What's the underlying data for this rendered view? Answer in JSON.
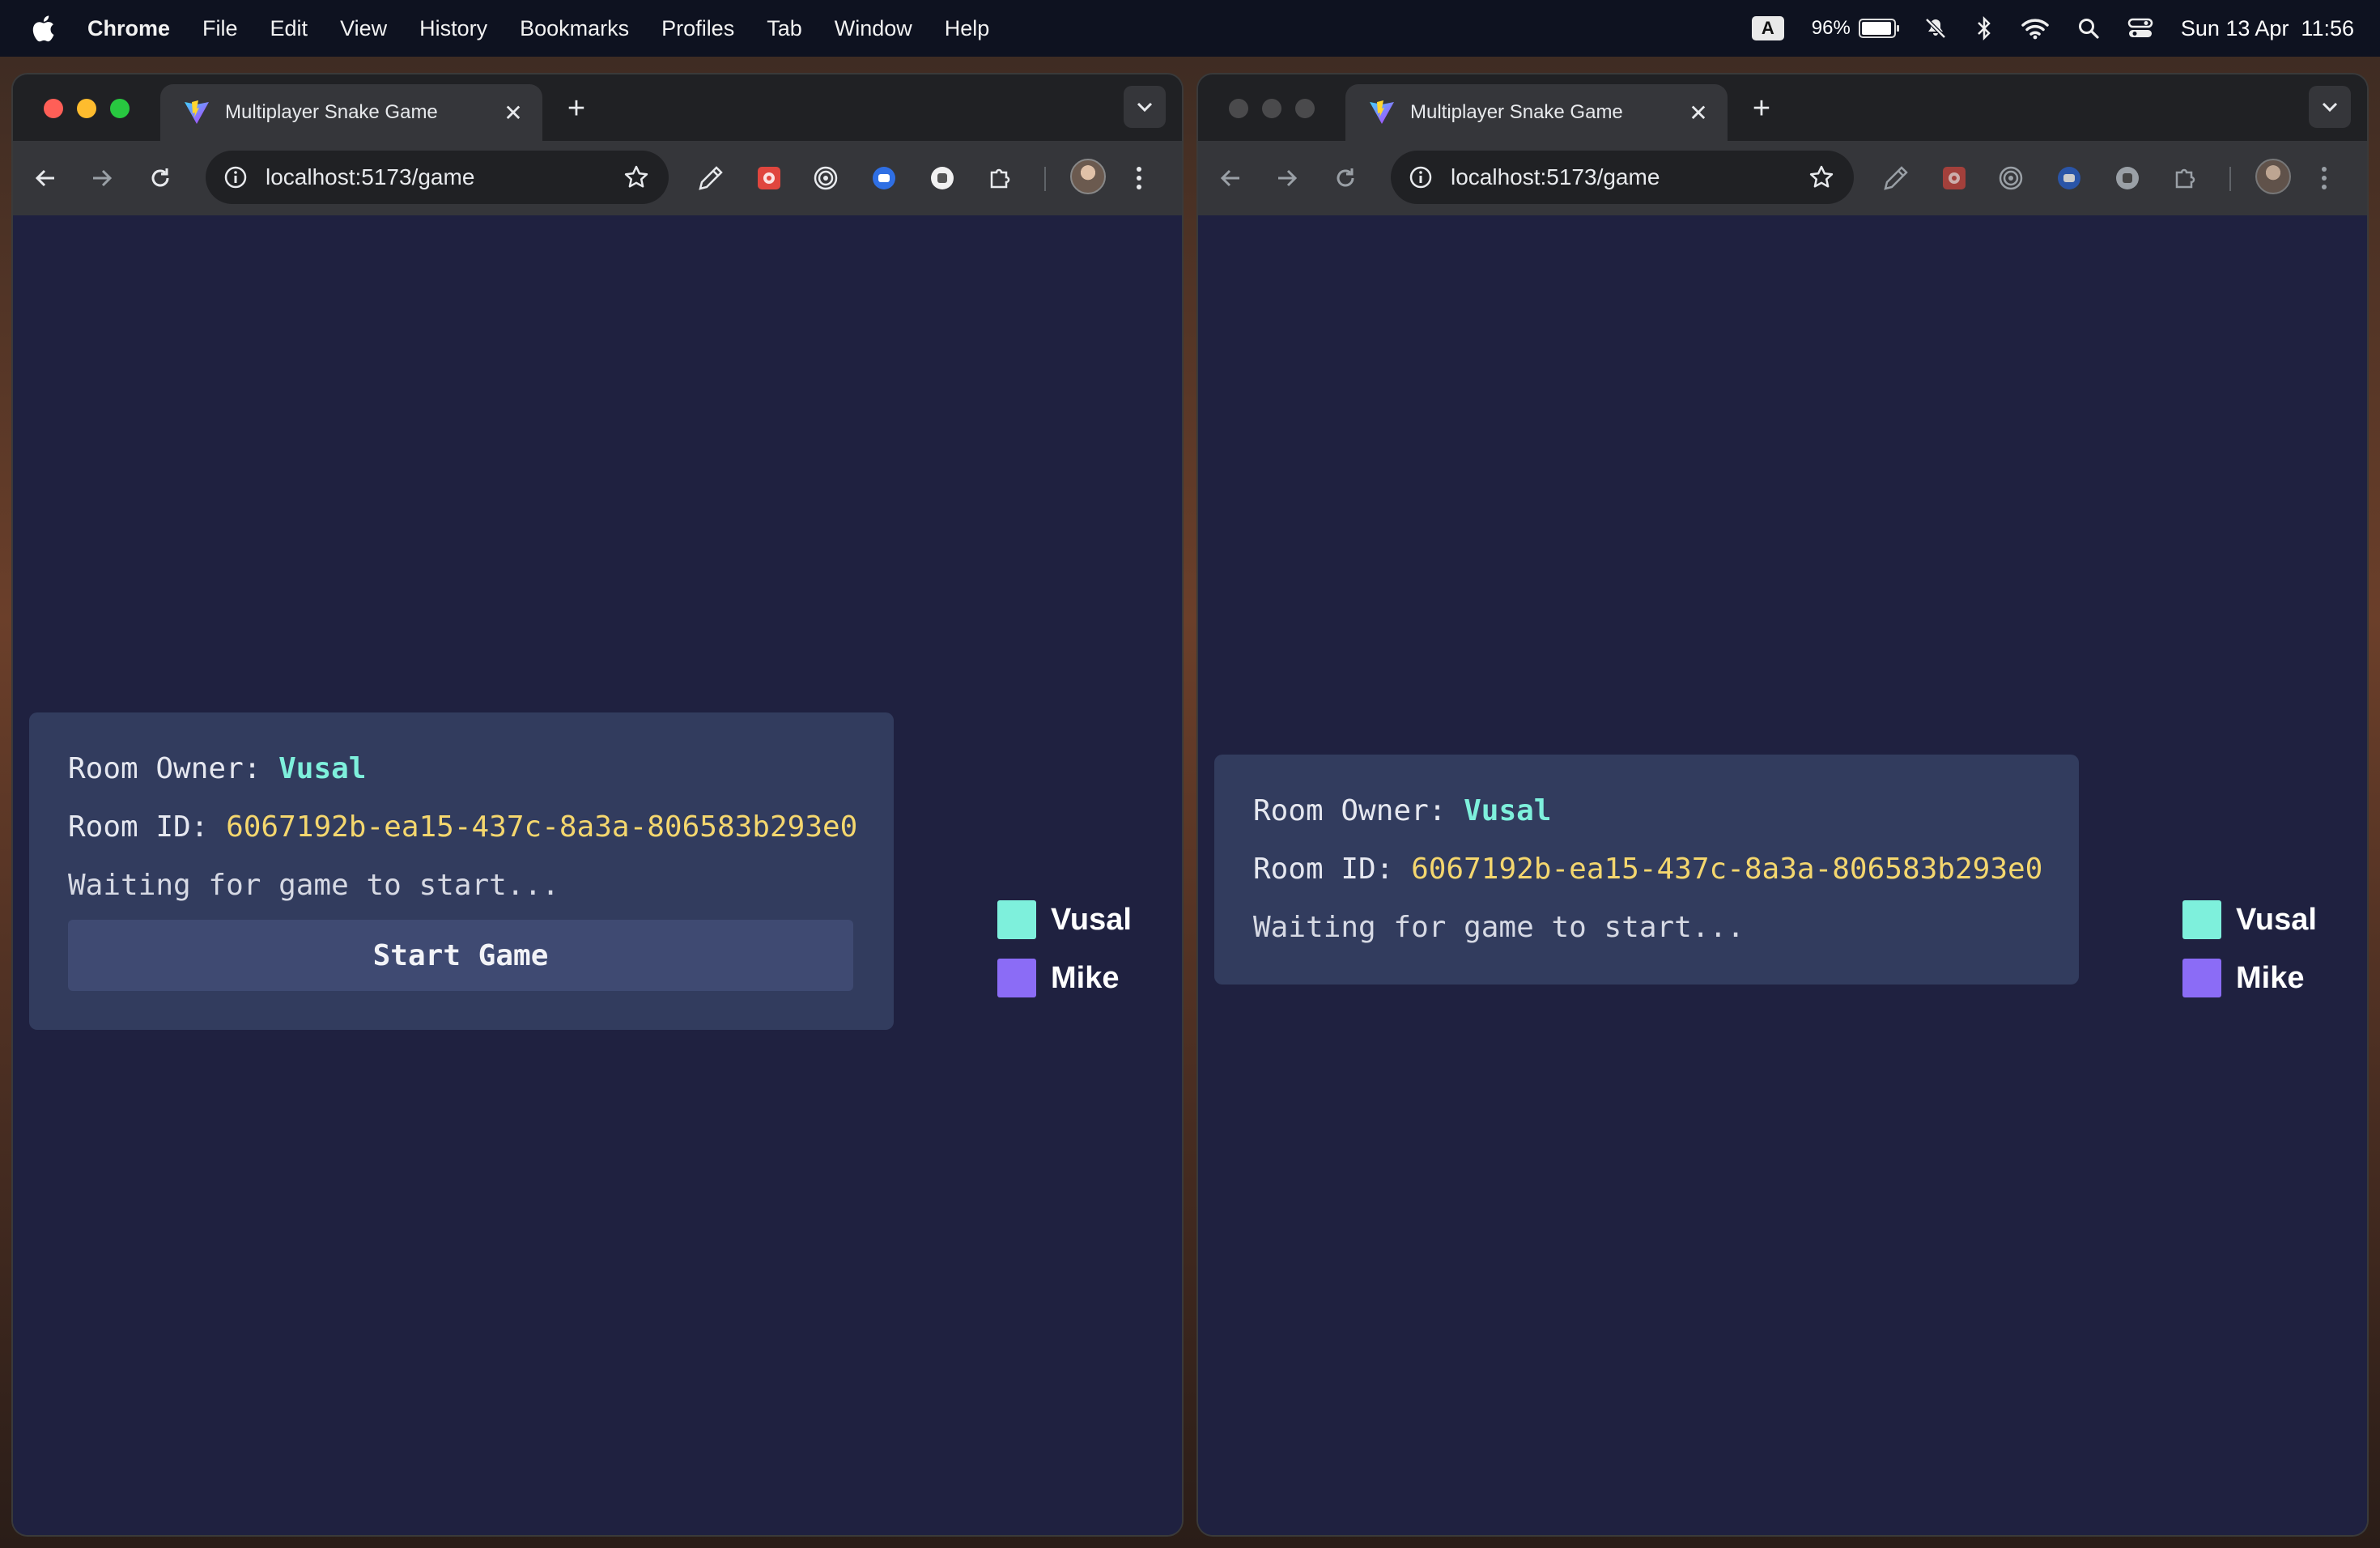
{
  "menubar": {
    "app_name": "Chrome",
    "items": [
      "File",
      "Edit",
      "View",
      "History",
      "Bookmarks",
      "Profiles",
      "Tab",
      "Window",
      "Help"
    ],
    "input_source": "A",
    "battery_percent": "96%",
    "battery_level": 0.96,
    "datetime": "Sun 13 Apr  11:56"
  },
  "windows": [
    {
      "tab_title": "Multiplayer Snake Game",
      "url": "localhost:5173/game",
      "focused": true,
      "game": {
        "owner_label": "Room Owner:",
        "owner_name": "Vusal",
        "room_id_label": "Room ID:",
        "room_id": "6067192b-ea15-437c-8a3a-806583b293e0",
        "status": "Waiting for game to start...",
        "start_button": "Start Game"
      },
      "players": [
        {
          "name": "Vusal",
          "color": "#7ef0dc"
        },
        {
          "name": "Mike",
          "color": "#8b6cf6"
        }
      ]
    },
    {
      "tab_title": "Multiplayer Snake Game",
      "url": "localhost:5173/game",
      "focused": false,
      "game": {
        "owner_label": "Room Owner:",
        "owner_name": "Vusal",
        "room_id_label": "Room ID:",
        "room_id": "6067192b-ea15-437c-8a3a-806583b293e0",
        "status": "Waiting for game to start..."
      },
      "players": [
        {
          "name": "Vusal",
          "color": "#7ef0dc"
        },
        {
          "name": "Mike",
          "color": "#8b6cf6"
        }
      ]
    }
  ],
  "colors": {
    "game_background": "#1f2140",
    "panel_background": "#323c5e",
    "owner_name": "#7ef0dc",
    "room_id": "#f5d76e",
    "button_background": "#3f4a72"
  }
}
